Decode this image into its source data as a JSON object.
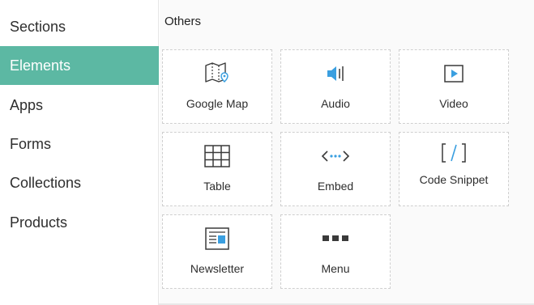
{
  "sidebar": {
    "items": [
      {
        "label": "Sections",
        "active": false
      },
      {
        "label": "Elements",
        "active": true
      },
      {
        "label": "Apps",
        "active": false
      },
      {
        "label": "Forms",
        "active": false
      },
      {
        "label": "Collections",
        "active": false
      },
      {
        "label": "Products",
        "active": false
      }
    ]
  },
  "main": {
    "section_title": "Others",
    "tiles": [
      {
        "label": "Google Map",
        "icon": "map-pin-icon"
      },
      {
        "label": "Audio",
        "icon": "audio-icon"
      },
      {
        "label": "Video",
        "icon": "video-play-icon"
      },
      {
        "label": "Table",
        "icon": "table-grid-icon"
      },
      {
        "label": "Embed",
        "icon": "embed-icon"
      },
      {
        "label": "Code Snippet",
        "icon": "code-snippet-icon"
      },
      {
        "label": "Newsletter",
        "icon": "newsletter-icon"
      },
      {
        "label": "Menu",
        "icon": "menu-dots-icon"
      }
    ]
  },
  "colors": {
    "accent": "#5cb8a3",
    "icon_blue": "#3a9fe0",
    "icon_dark": "#3a3a3a"
  }
}
